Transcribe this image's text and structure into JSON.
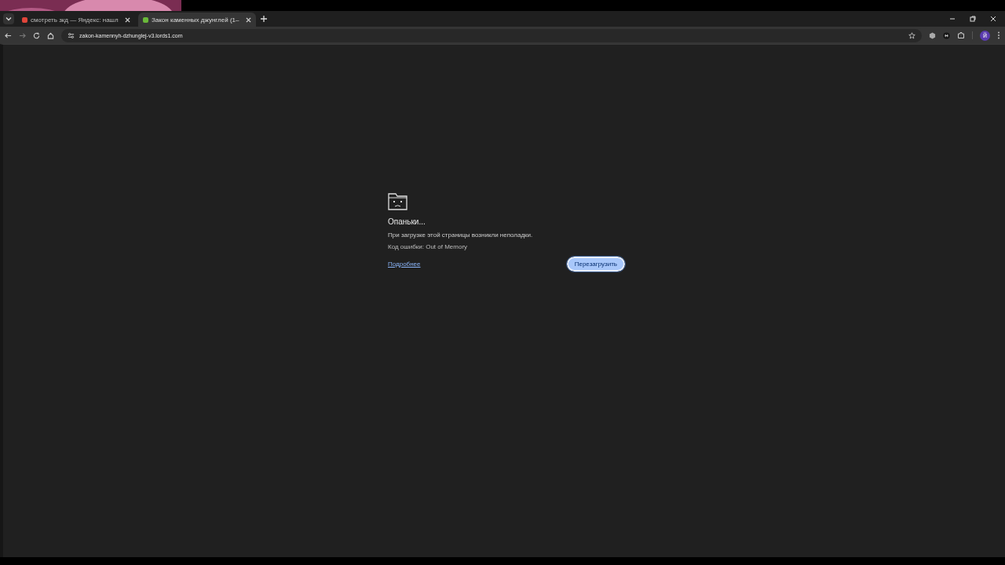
{
  "tabs": [
    {
      "title": "смотреть зкд — Яндекс: нашл",
      "color": "#e0453a",
      "selected": false
    },
    {
      "title": "Закон каменных джунглей (1–",
      "color": "#6ab83a",
      "selected": true
    }
  ],
  "address_bar": {
    "url": "zakon-kamennyh-dzhunglej-v3.lords1.com"
  },
  "profile": {
    "initial": "й"
  },
  "error": {
    "title": "Опаньки...",
    "message": "При загрузке этой страницы возникли неполадки.",
    "code": "Код ошибки: Out of Memory",
    "details_link": "Подробнее",
    "reload_button": "Перезагрузить"
  }
}
